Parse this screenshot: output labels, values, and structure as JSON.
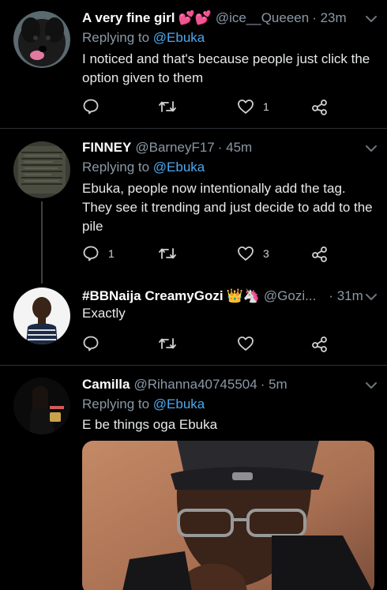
{
  "tweets": [
    {
      "name": "A very fine girl",
      "name_emoji": "💕💕",
      "handle": "@ice__Queeen",
      "time": "· 23m",
      "replying_label": "Replying to",
      "replying_to": "@Ebuka",
      "text": "I noticed and that's because people just click the option given to them",
      "reply_count": "",
      "retweet_count": "",
      "like_count": "1"
    },
    {
      "name": "FINNEY",
      "handle": "@BarneyF17",
      "time": "· 45m",
      "replying_label": "Replying to",
      "replying_to": "@Ebuka",
      "text": "Ebuka, people now intentionally add the tag. They see it trending and just decide to add to the pile",
      "reply_count": "1",
      "retweet_count": "",
      "like_count": "3"
    },
    {
      "name": "#BBNaija CreamyGozi",
      "name_emoji": "👑🦄",
      "handle": "@Gozi...",
      "time": "· 31m",
      "text": "Exactly",
      "reply_count": "",
      "retweet_count": "",
      "like_count": ""
    },
    {
      "name": "Camilla",
      "handle": "@Rihanna40745504",
      "time": "· 5m",
      "replying_label": "Replying to",
      "replying_to": "@Ebuka",
      "text": "E be things oga Ebuka"
    }
  ],
  "icons": {
    "reply": "reply-icon",
    "retweet": "retweet-icon",
    "like": "heart-icon",
    "share": "share-icon",
    "more": "chevron-down-icon"
  },
  "colors": {
    "background": "#000000",
    "mention": "#4ea8ec",
    "secondary_text": "#8b98a5",
    "divider": "#2f3336"
  }
}
